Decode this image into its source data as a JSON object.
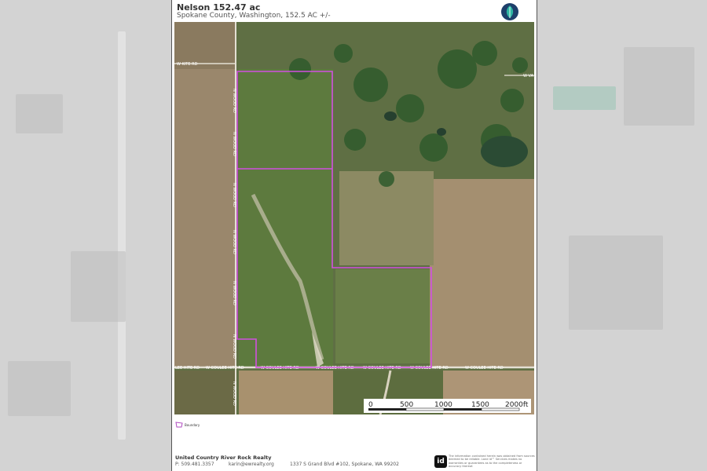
{
  "header": {
    "title": "Nelson 152.47 ac",
    "subtitle": "Spokane County, Washington, 152.5 AC +/-"
  },
  "map": {
    "roads": {
      "w_kite_rd": "W KITE RD",
      "w_va": "W VA",
      "n_wood_rd": "N WOOD RD",
      "coulee_hite_left": "LEE HITE RD",
      "w_coulee_hite_rd": "W COULEE HITE RD"
    },
    "boundary_color": "#d24fe0",
    "scale_bar": {
      "labels": [
        "0",
        "500",
        "1000",
        "1500",
        "2000ft"
      ]
    }
  },
  "legend": {
    "label": "Boundary",
    "color": "#b04cc0"
  },
  "footer": {
    "company": "United Country River Rock Realty",
    "phone": "P: 509.481.3357",
    "email": "karin@ewrealty.org",
    "address": "1337 S Grand Blvd #102, Spokane, WA 99202",
    "id_logo": "id",
    "disclaimer": "The information contained herein was obtained from sources deemed to be reliable. Land id™ Services makes no warranties or guarantees as to the completeness or accuracy thereof."
  }
}
